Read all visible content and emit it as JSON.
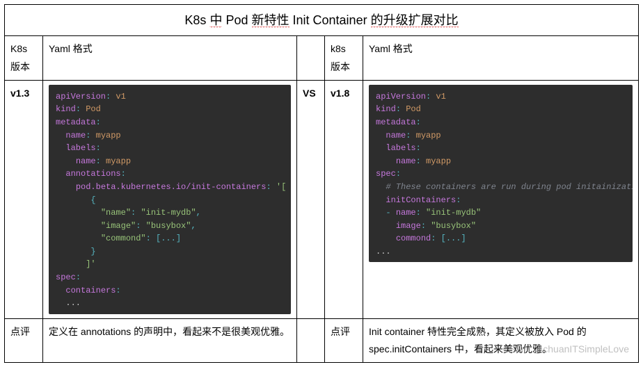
{
  "title_parts": [
    "K8s",
    "中",
    "Pod",
    "新特性",
    "Init Container",
    "的升级扩展对比"
  ],
  "headers": {
    "left_ver": "K8s\n版本",
    "left_yaml": "Yaml 格式",
    "right_ver": "k8s\n版本",
    "right_yaml": "Yaml 格式"
  },
  "vs": "VS",
  "left": {
    "version": "v1.3",
    "code": [
      [
        [
          "k-key",
          "apiVersion"
        ],
        [
          "k-pun",
          ": "
        ],
        [
          "k-val",
          "v1"
        ]
      ],
      [
        [
          "k-key",
          "kind"
        ],
        [
          "k-pun",
          ": "
        ],
        [
          "k-val",
          "Pod"
        ]
      ],
      [
        [
          "k-key",
          "metadata"
        ],
        [
          "k-pun",
          ":"
        ]
      ],
      [
        [
          "k-txt",
          "  "
        ],
        [
          "k-key",
          "name"
        ],
        [
          "k-pun",
          ": "
        ],
        [
          "k-val",
          "myapp"
        ]
      ],
      [
        [
          "k-txt",
          "  "
        ],
        [
          "k-key",
          "labels"
        ],
        [
          "k-pun",
          ":"
        ]
      ],
      [
        [
          "k-txt",
          "    "
        ],
        [
          "k-key",
          "name"
        ],
        [
          "k-pun",
          ": "
        ],
        [
          "k-val",
          "myapp"
        ]
      ],
      [
        [
          "k-txt",
          "  "
        ],
        [
          "k-key",
          "annotations"
        ],
        [
          "k-pun",
          ":"
        ]
      ],
      [
        [
          "k-txt",
          "    "
        ],
        [
          "k-key",
          "pod.beta.kubernetes.io/init-containers"
        ],
        [
          "k-pun",
          ": "
        ],
        [
          "k-str",
          "'["
        ]
      ],
      [
        [
          "k-txt",
          "       "
        ],
        [
          "k-pun",
          "{"
        ]
      ],
      [
        [
          "k-txt",
          "         "
        ],
        [
          "k-str",
          "\"name\""
        ],
        [
          "k-pun",
          ": "
        ],
        [
          "k-str",
          "\"init-mydb\""
        ],
        [
          "k-pun",
          ","
        ]
      ],
      [
        [
          "k-txt",
          "         "
        ],
        [
          "k-str",
          "\"image\""
        ],
        [
          "k-pun",
          ": "
        ],
        [
          "k-str",
          "\"busybox\""
        ],
        [
          "k-pun",
          ","
        ]
      ],
      [
        [
          "k-txt",
          "         "
        ],
        [
          "k-str",
          "\"commond\""
        ],
        [
          "k-pun",
          ": "
        ],
        [
          "k-pun",
          "[...]"
        ]
      ],
      [
        [
          "k-txt",
          "       "
        ],
        [
          "k-pun",
          "}"
        ]
      ],
      [
        [
          "k-txt",
          "      "
        ],
        [
          "k-str",
          "]'"
        ]
      ],
      [
        [
          "k-key",
          "spec"
        ],
        [
          "k-pun",
          ":"
        ]
      ],
      [
        [
          "k-txt",
          "  "
        ],
        [
          "k-key",
          "containers"
        ],
        [
          "k-pun",
          ":"
        ]
      ],
      [
        [
          "k-txt",
          "  "
        ],
        [
          "k-txt",
          "..."
        ]
      ]
    ],
    "comment_label": "点评",
    "comment_text": "定义在 annotations 的声明中，看起来不是很美观优雅。"
  },
  "right": {
    "version": "v1.8",
    "code": [
      [
        [
          "k-key",
          "apiVersion"
        ],
        [
          "k-pun",
          ": "
        ],
        [
          "k-val",
          "v1"
        ]
      ],
      [
        [
          "k-key",
          "kind"
        ],
        [
          "k-pun",
          ": "
        ],
        [
          "k-val",
          "Pod"
        ]
      ],
      [
        [
          "k-key",
          "metadata"
        ],
        [
          "k-pun",
          ":"
        ]
      ],
      [
        [
          "k-txt",
          "  "
        ],
        [
          "k-key",
          "name"
        ],
        [
          "k-pun",
          ": "
        ],
        [
          "k-val",
          "myapp"
        ]
      ],
      [
        [
          "k-txt",
          "  "
        ],
        [
          "k-key",
          "labels"
        ],
        [
          "k-pun",
          ":"
        ]
      ],
      [
        [
          "k-txt",
          "    "
        ],
        [
          "k-key",
          "name"
        ],
        [
          "k-pun",
          ": "
        ],
        [
          "k-val",
          "myapp"
        ]
      ],
      [
        [
          "k-key",
          "spec"
        ],
        [
          "k-pun",
          ":"
        ]
      ],
      [
        [
          "k-txt",
          "  "
        ],
        [
          "k-cmt",
          "# These containers are run during pod initainization."
        ]
      ],
      [
        [
          "k-txt",
          "  "
        ],
        [
          "k-key",
          "initContainers"
        ],
        [
          "k-pun",
          ":"
        ]
      ],
      [
        [
          "k-txt",
          "  "
        ],
        [
          "k-pun",
          "- "
        ],
        [
          "k-key",
          "name"
        ],
        [
          "k-pun",
          ": "
        ],
        [
          "k-str",
          "\"init-mydb\""
        ]
      ],
      [
        [
          "k-txt",
          "    "
        ],
        [
          "k-key",
          "image"
        ],
        [
          "k-pun",
          ": "
        ],
        [
          "k-str",
          "\"busybox\""
        ]
      ],
      [
        [
          "k-txt",
          "    "
        ],
        [
          "k-key",
          "commond"
        ],
        [
          "k-pun",
          ": "
        ],
        [
          "k-pun",
          "[...]"
        ]
      ],
      [
        [
          "k-txt",
          "..."
        ]
      ]
    ],
    "comment_label": "点评",
    "comment_text": "Init container 特性完全成熟，其定义被放入 Pod 的 spec.initContainers 中，看起来美观优雅。"
  },
  "watermark": "CSDN @chuanITSimpleLove"
}
